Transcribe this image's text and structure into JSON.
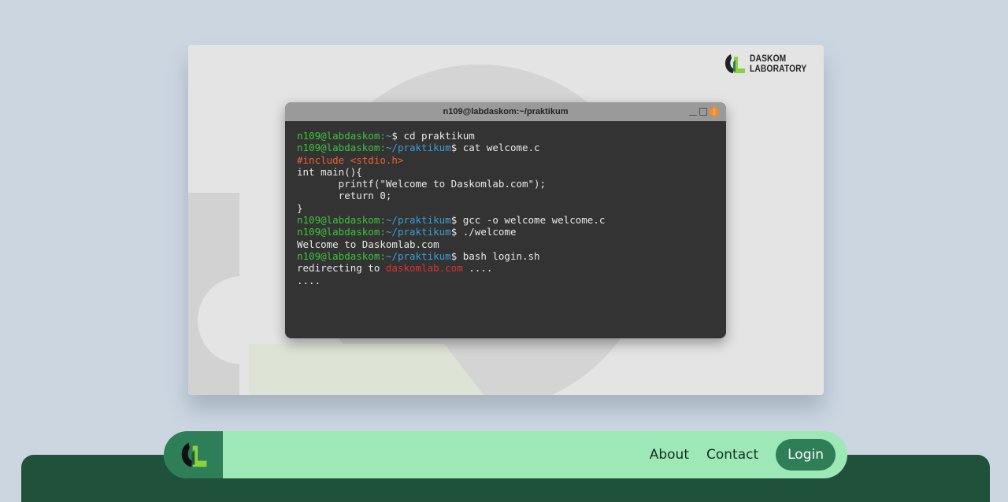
{
  "brand": {
    "line1": "DASKOM",
    "line2": "LABORATORY",
    "colors": {
      "green": "#2e7e58",
      "lime": "#8bd33c",
      "dark": "#222222"
    }
  },
  "terminal": {
    "title": "n109@labdaskom:~/praktikum",
    "lines": [
      [
        {
          "t": "n109@labdaskom:",
          "c": "user"
        },
        {
          "t": "~",
          "c": "path"
        },
        {
          "t": "$ cd praktikum",
          "c": ""
        }
      ],
      [
        {
          "t": "n109@labdaskom:",
          "c": "user"
        },
        {
          "t": "~/praktikum",
          "c": "path"
        },
        {
          "t": "$ cat welcome.c",
          "c": ""
        }
      ],
      [
        {
          "t": "#include <stdio.h>",
          "c": "inc"
        }
      ],
      [
        {
          "t": "int main(){",
          "c": ""
        }
      ],
      [
        {
          "t": "       printf(\"Welcome to Daskomlab.com\");",
          "c": ""
        }
      ],
      [
        {
          "t": "       return 0;",
          "c": ""
        }
      ],
      [
        {
          "t": "}",
          "c": ""
        }
      ],
      [
        {
          "t": "n109@labdaskom:",
          "c": "user"
        },
        {
          "t": "~/praktikum",
          "c": "path"
        },
        {
          "t": "$ gcc -o welcome welcome.c",
          "c": ""
        }
      ],
      [
        {
          "t": "n109@labdaskom:",
          "c": "user"
        },
        {
          "t": "~/praktikum",
          "c": "path"
        },
        {
          "t": "$ ./welcome",
          "c": ""
        }
      ],
      [
        {
          "t": "Welcome to Daskomlab.com",
          "c": ""
        }
      ],
      [
        {
          "t": "n109@labdaskom:",
          "c": "user"
        },
        {
          "t": "~/praktikum",
          "c": "path"
        },
        {
          "t": "$ bash login.sh",
          "c": ""
        }
      ],
      [
        {
          "t": "redirecting to ",
          "c": ""
        },
        {
          "t": "daskomlab.com",
          "c": "link"
        },
        {
          "t": " ....",
          "c": ""
        }
      ],
      [
        {
          "t": "....",
          "c": ""
        }
      ]
    ],
    "colors": {
      "user": "#3cc43c",
      "path": "#3a9fd6",
      "include": "#f0602e",
      "link": "#e03131"
    }
  },
  "nav": {
    "about": "About",
    "contact": "Contact",
    "login": "Login"
  }
}
